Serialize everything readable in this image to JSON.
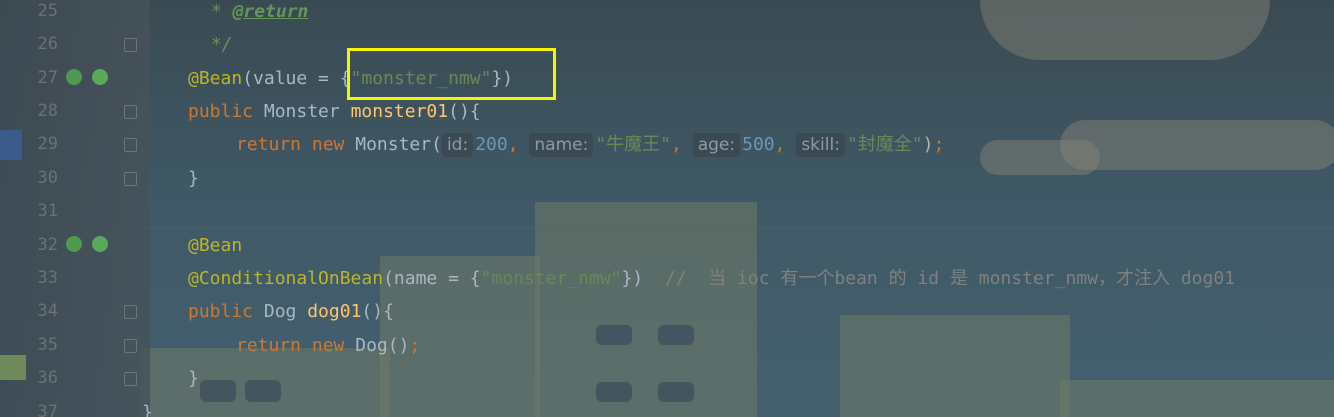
{
  "editor": {
    "lines": [
      {
        "num": "25"
      },
      {
        "num": "26"
      },
      {
        "num": "27"
      },
      {
        "num": "28"
      },
      {
        "num": "29"
      },
      {
        "num": "30"
      },
      {
        "num": "31"
      },
      {
        "num": "32"
      },
      {
        "num": "33"
      },
      {
        "num": "34"
      },
      {
        "num": "35"
      },
      {
        "num": "36"
      },
      {
        "num": "37"
      }
    ],
    "tokens": {
      "l25_star": " * ",
      "l25_tag": "@return",
      "l26": " */",
      "l27_ann": "@Bean",
      "l27_a": "(value = ",
      "l27_b": "{",
      "l27_str": "\"monster_nmw\"",
      "l27_c": "})",
      "l28_kw": "public",
      "l28_type": " Monster ",
      "l28_fn": "monster01",
      "l28_rest": "(){",
      "l29_kw1": "return",
      "l29_kw2": " new",
      "l29_cls": " Monster(",
      "l29_h1": "id:",
      "l29_v1": "200",
      "l29_c1": ", ",
      "l29_h2": "name:",
      "l29_v2": "\"牛魔王\"",
      "l29_c2": ", ",
      "l29_h3": "age:",
      "l29_v3": "500",
      "l29_c3": ", ",
      "l29_h4": "skill:",
      "l29_v4": "\"封魔全\"",
      "l29_end1": ")",
      "l29_end2": ";",
      "l30": "}",
      "l32_ann": "@Bean",
      "l33_ann": "@ConditionalOnBean",
      "l33_a": "(name = {",
      "l33_str": "\"monster_nmw\"",
      "l33_b": "})  ",
      "l33_cmt": "//  当 ioc 有一个bean 的 id 是 monster_nmw，才注入 dog01",
      "l34_kw": "public",
      "l34_type": " Dog ",
      "l34_fn": "dog01",
      "l34_rest": "(){",
      "l35_kw1": "return",
      "l35_kw2": " new",
      "l35_cls": " Dog()",
      "l35_end": ";",
      "l36": "}",
      "l37": "}"
    }
  },
  "colors": {
    "highlight_box": "#f5f500",
    "keyword": "#cc7832",
    "annotation": "#bbb529",
    "string": "#6a8759",
    "number": "#6897bb",
    "method": "#ffc66d"
  },
  "icons": [
    "bean-gutter-icon",
    "fold-marker-icon"
  ]
}
